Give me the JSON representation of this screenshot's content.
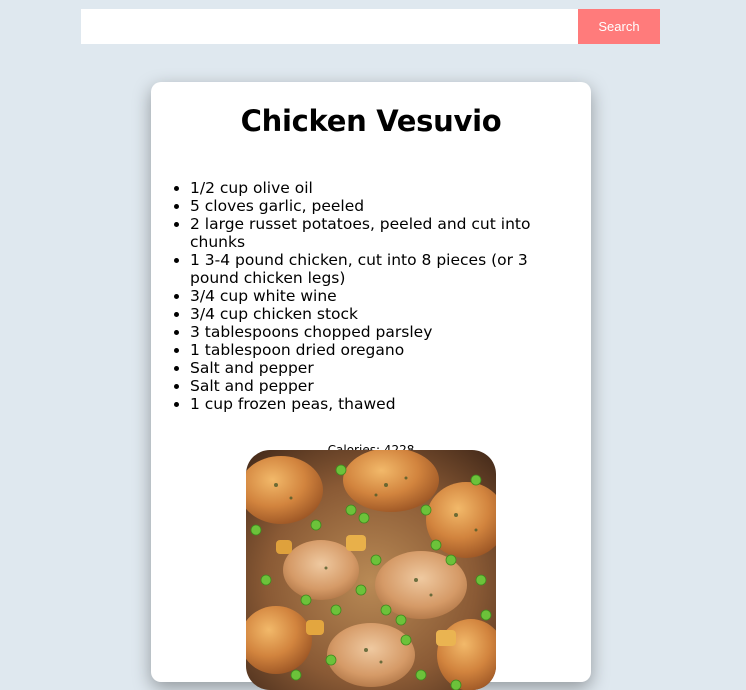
{
  "search": {
    "placeholder": "",
    "value": "",
    "button_label": "Search"
  },
  "recipe": {
    "title": "Chicken Vesuvio",
    "ingredients": [
      "1/2 cup olive oil",
      "5 cloves garlic, peeled",
      "2 large russet potatoes, peeled and cut into chunks",
      "1 3-4 pound chicken, cut into 8 pieces (or 3 pound chicken legs)",
      "3/4 cup white wine",
      "3/4 cup chicken stock",
      "3 tablespoons chopped parsley",
      "1 tablespoon dried oregano",
      "Salt and pepper",
      "Salt and pepper",
      "1 cup frozen peas, thawed"
    ],
    "calories_text": "Calories: 4228"
  },
  "colors": {
    "page_background": "#dfe8ef",
    "search_button": "#ff7b7b",
    "card_background": "#ffffff"
  }
}
